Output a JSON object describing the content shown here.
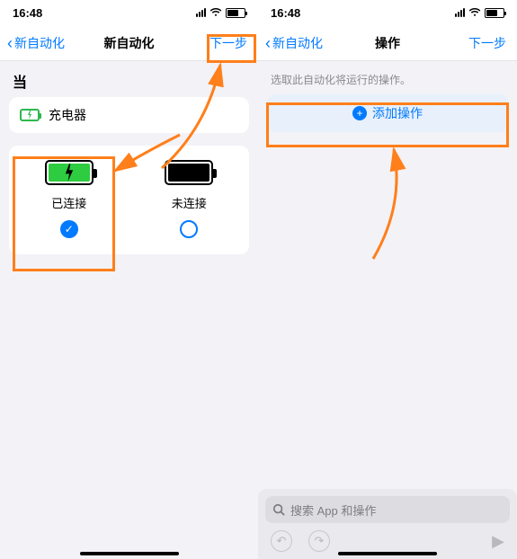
{
  "status": {
    "time": "16:48"
  },
  "left": {
    "nav": {
      "back": "新自动化",
      "title": "新自动化",
      "next": "下一步"
    },
    "whenLabel": "当",
    "triggerRow": {
      "label": "充电器"
    },
    "options": {
      "connected": {
        "label": "已连接"
      },
      "disconnected": {
        "label": "未连接"
      }
    }
  },
  "right": {
    "nav": {
      "back": "新自动化",
      "title": "操作",
      "next": "下一步"
    },
    "description": "选取此自动化将运行的操作。",
    "addAction": "添加操作",
    "search": {
      "placeholder": "搜索 App 和操作"
    }
  },
  "colors": {
    "accent": "#007aff",
    "highlight": "#ff7f1a",
    "green": "#2ecc40"
  }
}
